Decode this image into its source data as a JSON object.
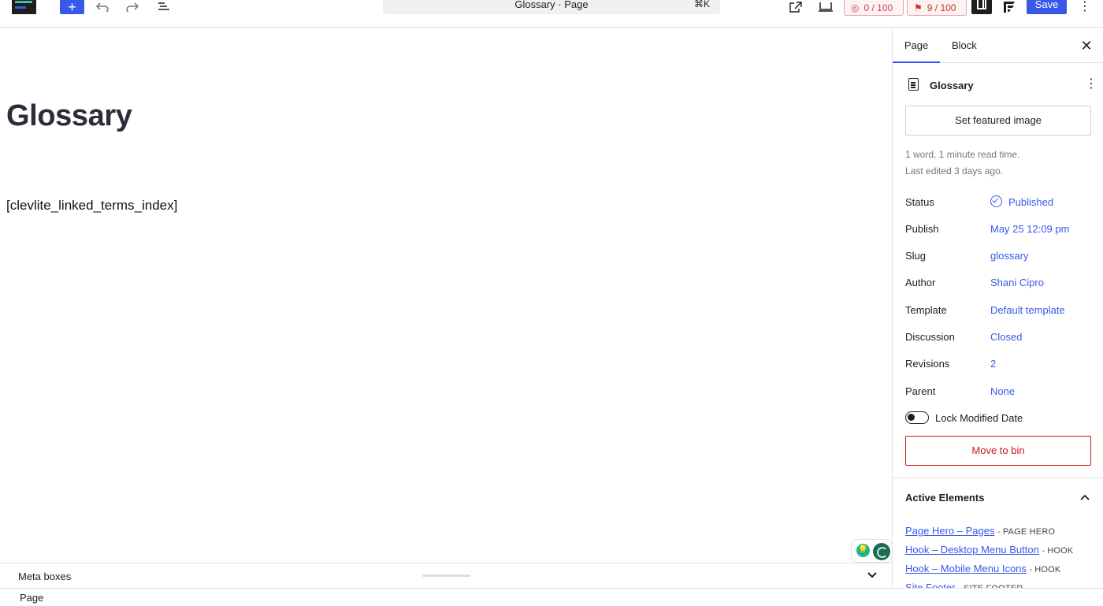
{
  "toolbar": {
    "command_title": "Glossary · Page",
    "command_shortcut": "⌘K",
    "score_a": "0 / 100",
    "score_b": "9 / 100",
    "save_label": "Save",
    "add_icon": "plus-icon",
    "undo_icon": "undo-icon",
    "redo_icon": "redo-icon",
    "list_icon": "list-view-icon",
    "more_icon": "more-vertical-icon"
  },
  "canvas": {
    "title": "Glossary",
    "shortcode": "[clevlite_linked_terms_index]"
  },
  "metabox": {
    "label": "Meta boxes"
  },
  "footer": {
    "breadcrumb": "Page"
  },
  "sidebar": {
    "tabs": [
      "Page",
      "Block"
    ],
    "doc_title": "Glossary",
    "featured_image_label": "Set featured image",
    "meta_line_1": "1 word, 1 minute read time.",
    "meta_line_2": "Last edited 3 days ago.",
    "properties": [
      {
        "label": "Status",
        "value": "Published"
      },
      {
        "label": "Publish",
        "value": "May 25 12:09 pm"
      },
      {
        "label": "Slug",
        "value": "glossary"
      },
      {
        "label": "Author",
        "value": "Shani Cipro"
      },
      {
        "label": "Template",
        "value": "Default template"
      },
      {
        "label": "Discussion",
        "value": "Closed"
      },
      {
        "label": "Revisions",
        "value": "2"
      },
      {
        "label": "Parent",
        "value": "None"
      }
    ],
    "lock_label": "Lock Modified Date",
    "lock_on": false,
    "bin_label": "Move to bin",
    "active_elements": {
      "title": "Active Elements",
      "items": [
        {
          "name": "Page Hero – Pages",
          "type": "PAGE HERO"
        },
        {
          "name": "Hook – Desktop Menu Button",
          "type": "HOOK"
        },
        {
          "name": "Hook – Mobile Menu Icons",
          "type": "HOOK"
        },
        {
          "name": "Site Footer",
          "type": "SITE FOOTER"
        }
      ]
    }
  },
  "colors": {
    "accent": "#3858e9",
    "danger": "#cc1818",
    "score_a": "#d63865",
    "score_b": "#cc3030"
  }
}
